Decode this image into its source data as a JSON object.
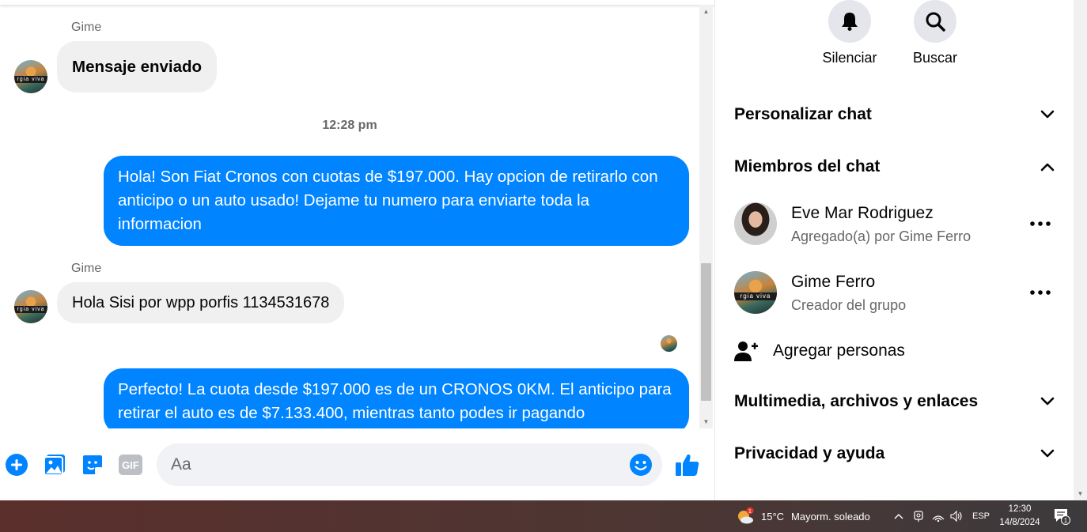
{
  "chat": {
    "messages": [
      {
        "sender": "Gime",
        "text": "Mensaje enviado"
      },
      {
        "timestamp": "12:28 pm"
      },
      {
        "text": "Hola! Son Fiat Cronos con cuotas de $197.000. Hay opcion de retirarlo con anticipo o un auto usado! Dejame tu numero para enviarte toda la informacion"
      },
      {
        "sender": "Gime",
        "text": "Hola Sisi por wpp porfis 1134531678"
      },
      {
        "text": "Perfecto! La cuota desde $197.000 es de un CRONOS 0KM. El anticipo para retirar el auto es de $7.133.400, mientras tanto podes ir pagando"
      }
    ],
    "avatar_text": "rgia viva"
  },
  "composer": {
    "placeholder": "Aa",
    "icons": [
      "plus-circle-icon",
      "image-icon",
      "sticker-icon",
      "gif-icon",
      "emoji-icon",
      "thumbs-up-icon"
    ],
    "gif_label": "GIF"
  },
  "panel": {
    "actions": [
      {
        "label": "Silenciar",
        "icon": "bell-icon"
      },
      {
        "label": "Buscar",
        "icon": "search-icon"
      }
    ],
    "sections": {
      "customize": "Personalizar chat",
      "members": "Miembros del chat",
      "media": "Multimedia, archivos y enlaces",
      "privacy": "Privacidad y ayuda"
    },
    "members": [
      {
        "name": "Eve Mar Rodriguez",
        "sub": "Agregado(a) por Gime Ferro"
      },
      {
        "name": "Gime Ferro",
        "sub": "Creador del grupo"
      }
    ],
    "add_people": "Agregar personas"
  },
  "taskbar": {
    "temperature": "15°C",
    "weather": "Mayorm. soleado",
    "weather_badge": "1",
    "language": "ESP",
    "time": "12:30",
    "date": "14/8/2024",
    "notification_count": "1"
  },
  "colors": {
    "accent": "#0084ff",
    "bubble_in": "#f0f0f0",
    "secondary_text": "#65676b"
  }
}
